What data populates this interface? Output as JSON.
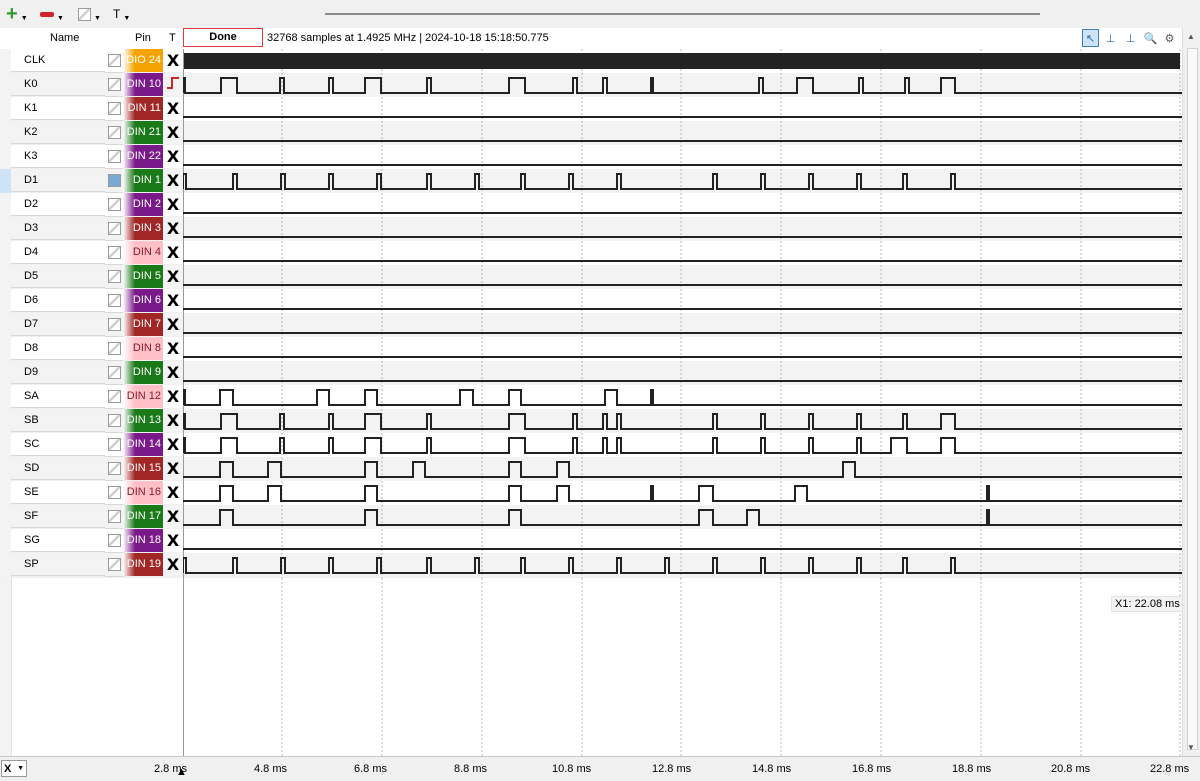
{
  "toolbar": {
    "add_label": "+",
    "remove_label": "",
    "edit_label": "",
    "text_label": "T"
  },
  "header": {
    "name": "Name",
    "pin": "Pin",
    "trig": "T"
  },
  "status": {
    "button": "Done",
    "info": "32768 samples at 1.4925 MHz | 2024-10-18 15:18:50.775"
  },
  "cursor": {
    "readout": "X1: 22.08 ms"
  },
  "bottom": {
    "selector": "X"
  },
  "time_axis": [
    "2.8 ms",
    "4.8 ms",
    "6.8 ms",
    "8.8 ms",
    "10.8 ms",
    "12.8 ms",
    "14.8 ms",
    "16.8 ms",
    "18.8 ms",
    "20.8 ms",
    "22.8 ms"
  ],
  "channels": [
    {
      "name": "CLK",
      "pin": "DIO 24",
      "color": "#f4a300",
      "trig": "X"
    },
    {
      "name": "K0",
      "pin": "DIN 10",
      "color": "#7a1a8a",
      "trig": "rise"
    },
    {
      "name": "K1",
      "pin": "DIN 11",
      "color": "#a12626",
      "trig": "X"
    },
    {
      "name": "K2",
      "pin": "DIN 21",
      "color": "#1a7a1a",
      "trig": "X"
    },
    {
      "name": "K3",
      "pin": "DIN 22",
      "color": "#7a1a8a",
      "trig": "X"
    },
    {
      "name": "D1",
      "pin": "DIN 1",
      "color": "#1a7a1a",
      "trig": "X"
    },
    {
      "name": "D2",
      "pin": "DIN 2",
      "color": "#7a1a8a",
      "trig": "X"
    },
    {
      "name": "D3",
      "pin": "DIN 3",
      "color": "#a12626",
      "trig": "X"
    },
    {
      "name": "D4",
      "pin": "DIN 4",
      "color": "#ffc0c8",
      "trig": "X"
    },
    {
      "name": "D5",
      "pin": "DIN 5",
      "color": "#1a7a1a",
      "trig": "X"
    },
    {
      "name": "D6",
      "pin": "DIN 6",
      "color": "#7a1a8a",
      "trig": "X"
    },
    {
      "name": "D7",
      "pin": "DIN 7",
      "color": "#a12626",
      "trig": "X"
    },
    {
      "name": "D8",
      "pin": "DIN 8",
      "color": "#ffc0c8",
      "trig": "X"
    },
    {
      "name": "D9",
      "pin": "DIN 9",
      "color": "#1a7a1a",
      "trig": "X"
    },
    {
      "name": "SA",
      "pin": "DIN 12",
      "color": "#ffc0c8",
      "trig": "X"
    },
    {
      "name": "SB",
      "pin": "DIN 13",
      "color": "#1a7a1a",
      "trig": "X"
    },
    {
      "name": "SC",
      "pin": "DIN 14",
      "color": "#7a1a8a",
      "trig": "X"
    },
    {
      "name": "SD",
      "pin": "DIN 15",
      "color": "#a12626",
      "trig": "X"
    },
    {
      "name": "SE",
      "pin": "DIN 16",
      "color": "#ffc0c8",
      "trig": "X"
    },
    {
      "name": "SF",
      "pin": "DIN 17",
      "color": "#1a7a1a",
      "trig": "X"
    },
    {
      "name": "SG",
      "pin": "DIN 18",
      "color": "#7a1a8a",
      "trig": "X"
    },
    {
      "name": "SP",
      "pin": "DIN 19",
      "color": "#a12626",
      "trig": "X"
    }
  ]
}
